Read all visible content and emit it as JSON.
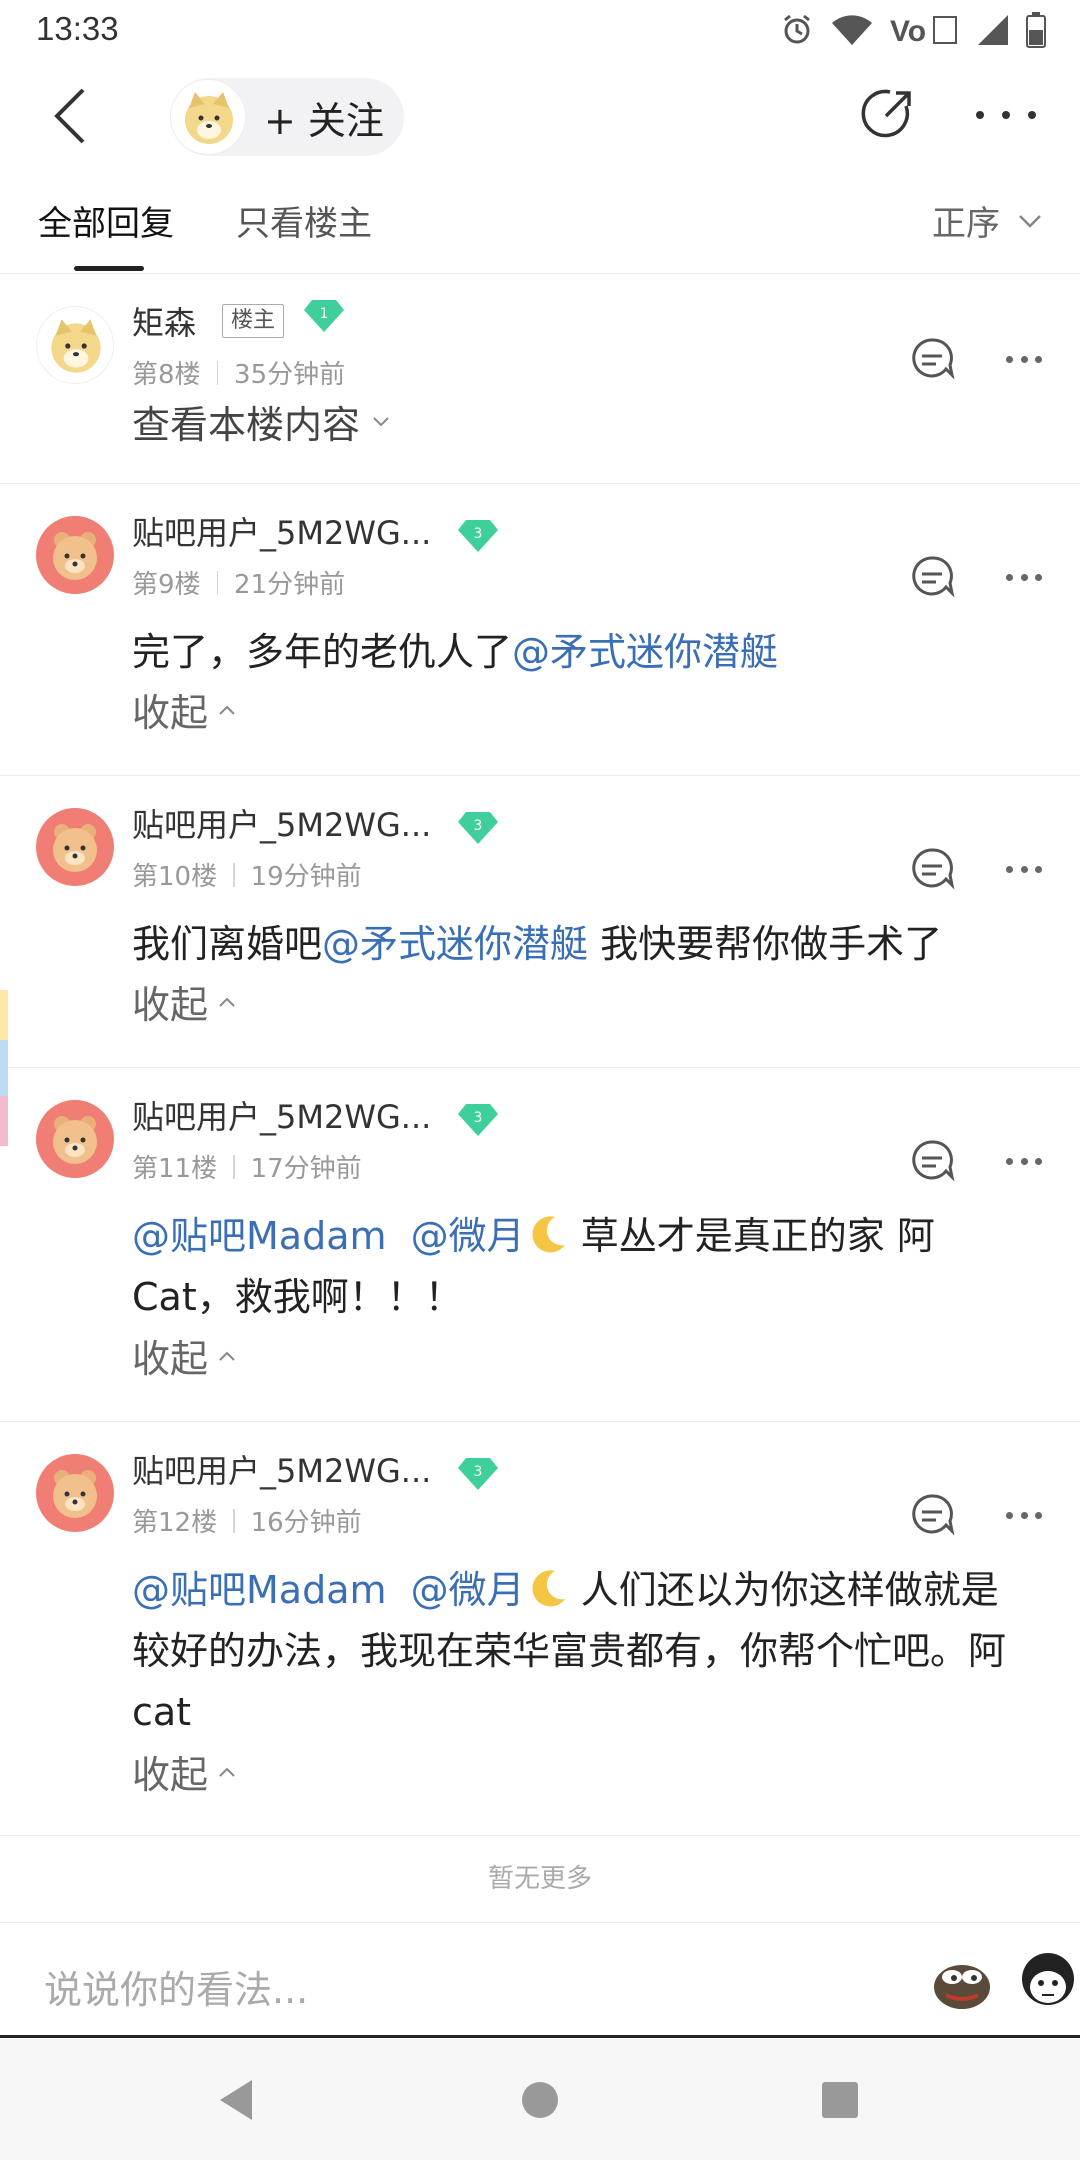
{
  "status_bar": {
    "time": "13:33"
  },
  "header": {
    "follow_label": "+ 关注"
  },
  "tabs": {
    "all_replies": "全部回复",
    "op_only": "只看楼主",
    "sort_label": "正序"
  },
  "posts": [
    {
      "username": "矩森",
      "host_tag": "楼主",
      "level": "1",
      "floor": "第8楼",
      "time": "35分钟前",
      "view_content": "查看本楼内容"
    },
    {
      "username": "贴吧用户_5M2WG...",
      "level": "3",
      "floor": "第9楼",
      "time": "21分钟前",
      "text_before": "完了，多年的老仇人了",
      "mention": "@矛式迷你潜艇",
      "collapse": "收起"
    },
    {
      "username": "贴吧用户_5M2WG...",
      "level": "3",
      "floor": "第10楼",
      "time": "19分钟前",
      "text_before": "我们离婚吧",
      "mention": "@矛式迷你潜艇",
      "text_after": " 我快要帮你做手术了",
      "collapse": "收起"
    },
    {
      "username": "贴吧用户_5M2WG...",
      "level": "3",
      "floor": "第11楼",
      "time": "17分钟前",
      "mention1": "@贴吧Madam",
      "mention2": "@微月",
      "text_after": " 草丛才是真正的家 阿Cat，救我啊！！！",
      "collapse": "收起"
    },
    {
      "username": "贴吧用户_5M2WG...",
      "level": "3",
      "floor": "第12楼",
      "time": "16分钟前",
      "mention1": "@贴吧Madam",
      "mention2": "@微月",
      "text_after": " 人们还以为你这样做就是较好的办法，我现在荣华富贵都有，你帮个忙吧。阿cat",
      "collapse": "收起"
    }
  ],
  "footer": {
    "no_more": "暂无更多",
    "input_placeholder": "说说你的看法..."
  },
  "colors": {
    "mention": "#3a6fb5",
    "level_badge": "#3ecf9a",
    "avatar_bg": "#f07e74"
  }
}
